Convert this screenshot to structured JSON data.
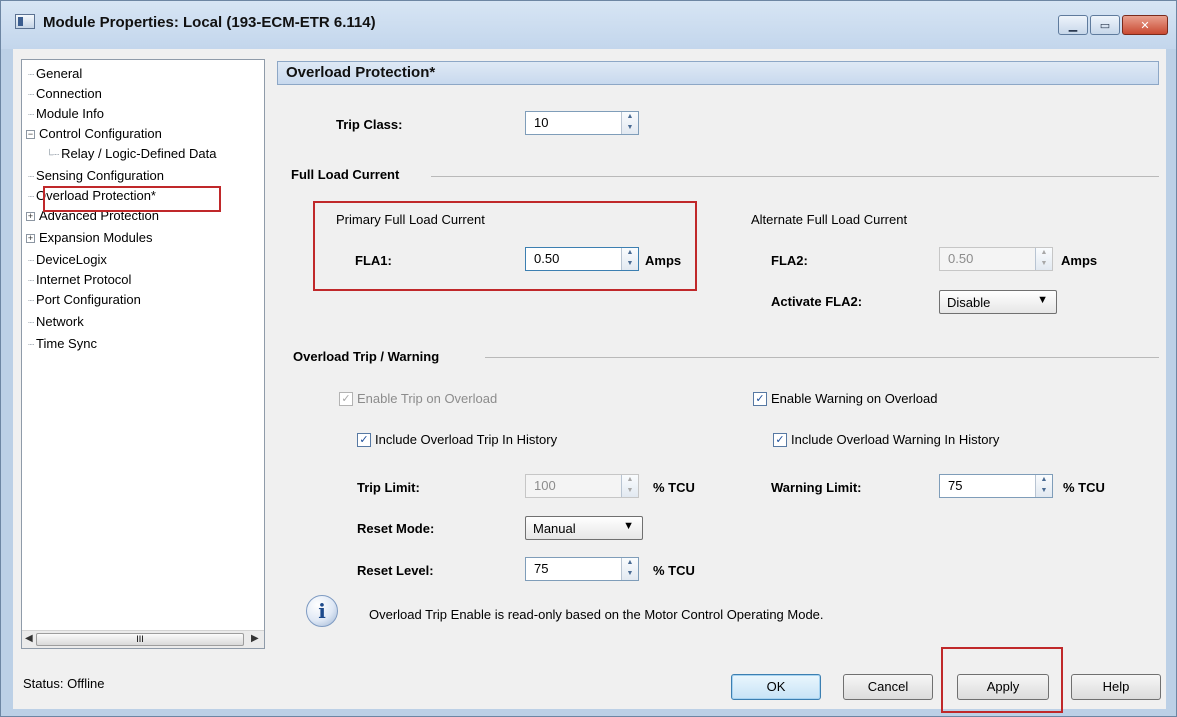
{
  "window": {
    "title": "Module Properties: Local (193-ECM-ETR 6.114)"
  },
  "tree": {
    "items": [
      {
        "label": "General",
        "level": 0,
        "expander": ""
      },
      {
        "label": "Connection",
        "level": 0,
        "expander": ""
      },
      {
        "label": "Module Info",
        "level": 0,
        "expander": ""
      },
      {
        "label": "Control Configuration",
        "level": 0,
        "expander": "−"
      },
      {
        "label": "Relay / Logic-Defined Data",
        "level": 1,
        "expander": ""
      },
      {
        "label": "Sensing Configuration",
        "level": 0,
        "expander": ""
      },
      {
        "label": "Overload Protection*",
        "level": 0,
        "expander": ""
      },
      {
        "label": "Advanced Protection",
        "level": 0,
        "expander": "+"
      },
      {
        "label": "Expansion Modules",
        "level": 0,
        "expander": "+"
      },
      {
        "label": "DeviceLogix",
        "level": 0,
        "expander": ""
      },
      {
        "label": "Internet Protocol",
        "level": 0,
        "expander": ""
      },
      {
        "label": "Port Configuration",
        "level": 0,
        "expander": ""
      },
      {
        "label": "Network",
        "level": 0,
        "expander": ""
      },
      {
        "label": "Time Sync",
        "level": 0,
        "expander": ""
      }
    ],
    "scroll_thumb": "III"
  },
  "status": {
    "label": "Status:",
    "value": "Offline"
  },
  "page": {
    "title": "Overload Protection*",
    "trip_class": {
      "label": "Trip Class:",
      "value": "10"
    },
    "full_load_current": {
      "section": "Full Load Current",
      "primary_title": "Primary Full Load Current",
      "fla1_label": "FLA1:",
      "fla1_value": "0.50",
      "alternate_title": "Alternate Full Load Current",
      "fla2_label": "FLA2:",
      "fla2_value": "0.50",
      "units": "Amps",
      "activate_label": "Activate FLA2:",
      "activate_value": "Disable"
    },
    "overload": {
      "section": "Overload Trip / Warning",
      "enable_trip": {
        "label": "Enable Trip on Overload",
        "checked": true,
        "disabled": true
      },
      "enable_warning": {
        "label": "Enable Warning on Overload",
        "checked": true
      },
      "include_trip_history": {
        "label": "Include Overload Trip In History",
        "checked": true
      },
      "include_warning_history": {
        "label": "Include Overload Warning In History",
        "checked": true
      },
      "trip_limit_label": "Trip Limit:",
      "trip_limit_value": "100",
      "warning_limit_label": "Warning Limit:",
      "warning_limit_value": "75",
      "reset_mode_label": "Reset Mode:",
      "reset_mode_value": "Manual",
      "reset_level_label": "Reset Level:",
      "reset_level_value": "75",
      "tcu_unit": "% TCU"
    },
    "info_message": "Overload Trip Enable is read-only based on the Motor Control Operating Mode."
  },
  "buttons": {
    "ok": "OK",
    "cancel": "Cancel",
    "apply": "Apply",
    "help": "Help"
  },
  "colors": {
    "highlight_box": "#c0282a",
    "header_bg": "#d6e3f2"
  }
}
